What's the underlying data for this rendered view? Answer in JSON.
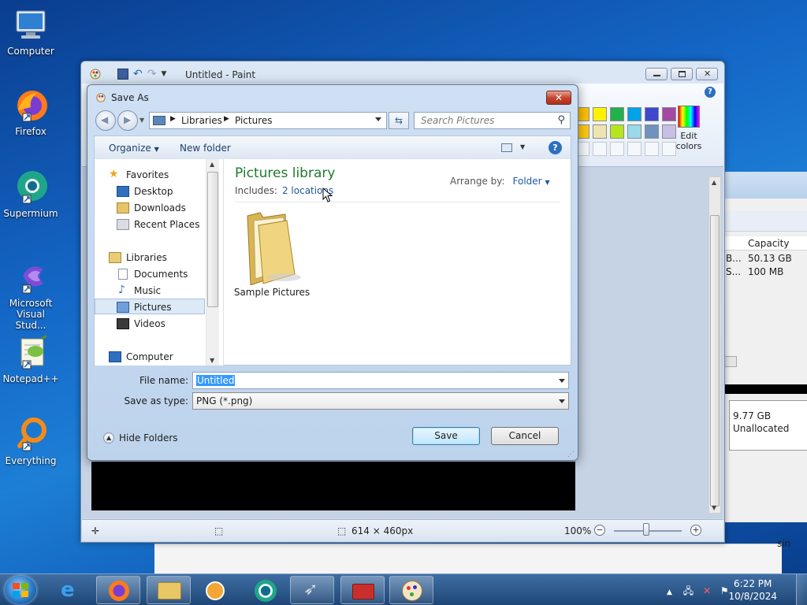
{
  "desktop": {
    "icons": [
      {
        "label": "Computer"
      },
      {
        "label": "Firefox"
      },
      {
        "label": "Supermium"
      },
      {
        "label": "Microsoft Visual Stud..."
      },
      {
        "label": "Notepad++"
      },
      {
        "label": "Everything"
      }
    ]
  },
  "background_window": {
    "column_header": "Capacity",
    "rows": [
      {
        "prefix": "B...",
        "value": "50.13 GB"
      },
      {
        "prefix": "S...",
        "value": "100 MB"
      }
    ],
    "unallocated_size": "9.77 GB",
    "unallocated_label": "Unallocated",
    "edge_text": "sin"
  },
  "paint": {
    "title": "Untitled - Paint",
    "edit_colors": [
      "Edit",
      "colors"
    ],
    "status_dimensions": "614 × 460px",
    "zoom": "100%",
    "zoom_minus": "−",
    "zoom_plus": "+"
  },
  "dialog": {
    "title": "Save As",
    "close": "✕",
    "breadcrumb": [
      "Libraries",
      "Pictures"
    ],
    "search_placeholder": "Search Pictures",
    "organize": "Organize",
    "new_folder": "New folder",
    "nav": {
      "favorites": "Favorites",
      "desktop": "Desktop",
      "downloads": "Downloads",
      "recent_places": "Recent Places",
      "libraries": "Libraries",
      "documents": "Documents",
      "music": "Music",
      "pictures": "Pictures",
      "videos": "Videos",
      "computer": "Computer"
    },
    "library_title": "Pictures library",
    "includes_label": "Includes:",
    "includes_link": "2 locations",
    "arrange_by_label": "Arrange by:",
    "arrange_by_value": "Folder",
    "folder_item": "Sample Pictures",
    "file_name_label": "File name:",
    "file_name_value": "Untitled",
    "save_as_type_label": "Save as type:",
    "save_as_type_value": "PNG (*.png)",
    "hide_folders": "Hide Folders",
    "save_button": "Save",
    "cancel_button": "Cancel"
  },
  "taskbar": {
    "time": "6:22 PM",
    "date": "10/8/2024"
  },
  "palette": [
    "#ffc000",
    "#fff200",
    "#22b14c",
    "#00a2e8",
    "#3f48cc",
    "#a349a4",
    "#ffc90e",
    "#efe4b0",
    "#b5e61d",
    "#99d9ea",
    "#7092be",
    "#c8bfe7"
  ],
  "colors": {
    "accent_green": "#1e7a2e",
    "link_blue": "#1b5aa6",
    "selection_blue": "#3399ff"
  }
}
